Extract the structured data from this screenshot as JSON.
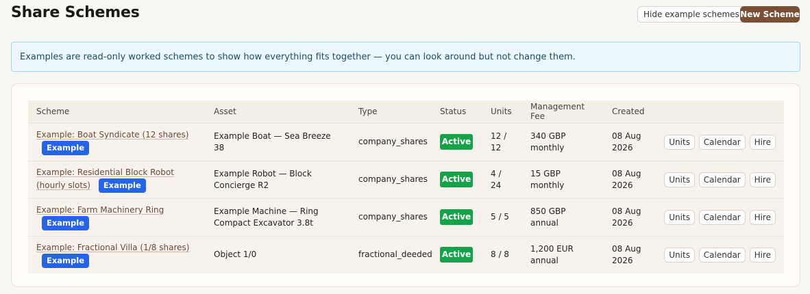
{
  "header": {
    "title": "Share Schemes",
    "hide_examples_label": "Hide example schemes",
    "new_scheme_label": "New Scheme"
  },
  "banner": {
    "text": "Examples are read-only worked schemes to show how everything fits together — you can look around but not change them."
  },
  "table": {
    "columns": [
      "Scheme",
      "Asset",
      "Type",
      "Status",
      "Units",
      "Management Fee",
      "Created",
      ""
    ],
    "rows": [
      {
        "scheme": "Example: Boat Syndicate (12 shares)",
        "badge": "Example",
        "asset": "Example Boat — Sea Breeze 38",
        "type": "company_shares",
        "status": "Active",
        "units": "12 / 12",
        "fee": "340 GBP monthly",
        "created": "08 Aug 2026",
        "actions": [
          "Units",
          "Calendar",
          "Hire"
        ]
      },
      {
        "scheme": "Example: Residential Block Robot (hourly slots)",
        "badge": "Example",
        "asset": "Example Robot — Block Concierge R2",
        "type": "company_shares",
        "status": "Active",
        "units": "4 / 24",
        "fee": "15 GBP monthly",
        "created": "08 Aug 2026",
        "actions": [
          "Units",
          "Calendar",
          "Hire"
        ]
      },
      {
        "scheme": "Example: Farm Machinery Ring",
        "badge": "Example",
        "asset": "Example Machine — Ring Compact Excavator 3.8t",
        "type": "company_shares",
        "status": "Active",
        "units": "5 / 5",
        "fee": "850 GBP annual",
        "created": "08 Aug 2026",
        "actions": [
          "Units",
          "Calendar",
          "Hire"
        ]
      },
      {
        "scheme": "Example: Fractional Villa (1/8 shares)",
        "badge": "Example",
        "asset": "Object 1/0",
        "type": "fractional_deeded",
        "status": "Active",
        "units": "8 / 8",
        "fee": "1,200 EUR annual",
        "created": "08 Aug 2026",
        "actions": [
          "Units",
          "Calendar",
          "Hire"
        ]
      }
    ]
  },
  "colors": {
    "accent_brown": "#7a4f33",
    "example_badge": "#2563eb",
    "active_badge": "#15a34a",
    "banner_bg": "#ebf6fd"
  }
}
